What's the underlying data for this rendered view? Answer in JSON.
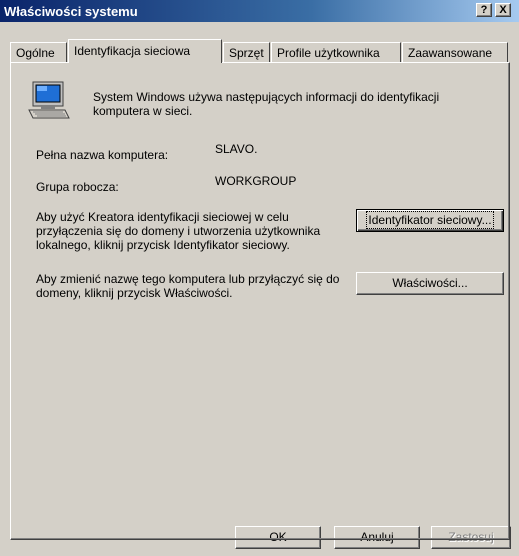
{
  "window": {
    "title": "Właściwości systemu",
    "help_label": "?",
    "close_label": "X"
  },
  "tabs": [
    {
      "label": "Ogólne"
    },
    {
      "label": "Identyfikacja sieciowa"
    },
    {
      "label": "Sprzęt"
    },
    {
      "label": "Profile użytkownika"
    },
    {
      "label": "Zaawansowane"
    }
  ],
  "active_tab": "Identyfikacja sieciowa",
  "content": {
    "intro": "System Windows używa następujących informacji do identyfikacji komputera w sieci.",
    "full_name_label": "Pełna nazwa komputera:",
    "full_name_value": "SLAVO.",
    "workgroup_label": "Grupa robocza:",
    "workgroup_value": "WORKGROUP",
    "wizard_text": "Aby użyć Kreatora identyfikacji sieciowej w celu przyłączenia się do domeny i utworzenia użytkownika lokalnego, kliknij przycisk Identyfikator sieciowy.",
    "network_id_button": "Identyfikator sieciowy...",
    "rename_text": "Aby zmienić nazwę tego komputera lub przyłączyć się do domeny, kliknij przycisk Właściwości.",
    "properties_button": "Właściwości..."
  },
  "footer": {
    "ok": "OK",
    "cancel": "Anuluj",
    "apply": "Zastosuj"
  },
  "icons": {
    "computer": "computer-icon",
    "help": "help-icon",
    "close": "close-icon"
  }
}
